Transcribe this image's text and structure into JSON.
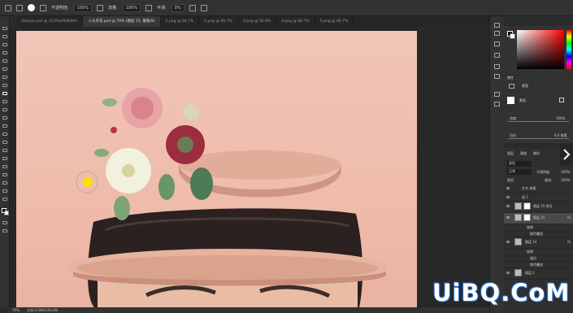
{
  "optbar": {
    "opacity_label": "不透明度:",
    "opacity_value": "100%",
    "flow_label": "流量:",
    "flow_value": "100%",
    "smooth_label": "平滑:",
    "smooth_value": "0%"
  },
  "tabs": [
    {
      "label": "dehuan.psd @ 15.9%(RGB/8#)"
    },
    {
      "label": "人头开花.psd @ 79% (图层 15, 蒙版/8)"
    },
    {
      "label": "1.png @ 66.7%"
    },
    {
      "label": "2.png @ 66.7%"
    },
    {
      "label": "3.png @ 50.0%"
    },
    {
      "label": "4.png @ 66.7%"
    },
    {
      "label": "5.png @ 66.7%"
    }
  ],
  "status": {
    "zoom": "79%",
    "doc": "文档:6.00M/100.0M"
  },
  "properties": {
    "title": "属性",
    "mask_label": "蒙版",
    "density_label": "浓度:",
    "density_value": "100%",
    "feather_label": "羽化:",
    "feather_value": "0.0 像素",
    "refine_label": "调整"
  },
  "layers": {
    "tabs": [
      "图层",
      "通道",
      "路径"
    ],
    "kind": "类型",
    "blend_mode": "正常",
    "opacity_label": "不透明度:",
    "opacity_value": "100%",
    "fill_label": "填充:",
    "fill_value": "100%",
    "lock_label": "锁定:",
    "rows": [
      {
        "name": "文字 海报"
      },
      {
        "name": "组 1"
      },
      {
        "name": "图层 15 拷贝"
      },
      {
        "name": "图层 15"
      },
      {
        "name": "效果"
      },
      {
        "name": "颜色叠加"
      },
      {
        "name": "图层 14"
      },
      {
        "name": "效果"
      },
      {
        "name": "描边"
      },
      {
        "name": "颜色叠加"
      },
      {
        "name": "图层 2"
      }
    ]
  },
  "watermark": "UiBQ.CoM",
  "colors": {
    "accent": "#1d6fd6",
    "canvas_pink": "#efbcab"
  }
}
